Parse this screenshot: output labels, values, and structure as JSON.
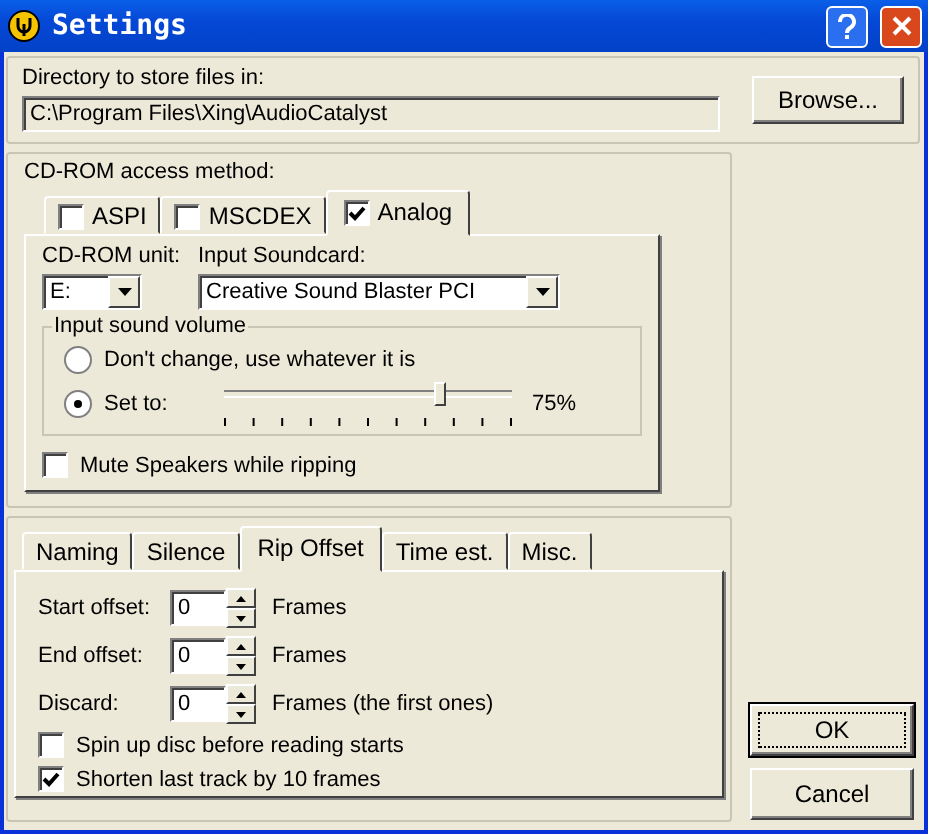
{
  "window": {
    "title": "Settings"
  },
  "directory": {
    "label": "Directory to store files in:",
    "value": "C:\\Program Files\\Xing\\AudioCatalyst",
    "button": "Browse..."
  },
  "cdrom": {
    "label": "CD-ROM access method:",
    "tabs": [
      {
        "label": "ASPI",
        "checked": false,
        "selected": false
      },
      {
        "label": "MSCDEX",
        "checked": false,
        "selected": false
      },
      {
        "label": "Analog",
        "checked": true,
        "selected": true
      }
    ],
    "unit": {
      "label": "CD-ROM unit:",
      "value": "E:"
    },
    "soundcard": {
      "label": "Input Soundcard:",
      "value": "Creative Sound Blaster PCI"
    },
    "volume": {
      "label": "Input sound volume",
      "options": [
        {
          "label": "Don't change, use whatever it is",
          "selected": false
        },
        {
          "label": "Set to:",
          "selected": true
        }
      ],
      "level": 0.75,
      "reading": "75%"
    },
    "mute": {
      "label": "Mute Speakers while ripping",
      "checked": false
    }
  },
  "settings_tabs": [
    {
      "label": "Naming",
      "selected": false
    },
    {
      "label": "Silence",
      "selected": false
    },
    {
      "label": "Rip Offset",
      "selected": true
    },
    {
      "label": "Time est.",
      "selected": false
    },
    {
      "label": "Misc.",
      "selected": false
    }
  ],
  "rip_offset": {
    "fields": [
      {
        "label": "Start offset:",
        "value": "0",
        "unit": "Frames"
      },
      {
        "label": "End offset:",
        "value": "0",
        "unit": "Frames"
      },
      {
        "label": "Discard:",
        "value": "0",
        "unit": "Frames (the first ones)"
      }
    ],
    "options": [
      {
        "label": "Spin up disc before reading starts",
        "checked": false
      },
      {
        "label": "Shorten last track by 10 frames",
        "checked": true
      }
    ]
  },
  "buttons": [
    {
      "label": "OK",
      "default": true
    },
    {
      "label": "Cancel",
      "default": false
    }
  ]
}
